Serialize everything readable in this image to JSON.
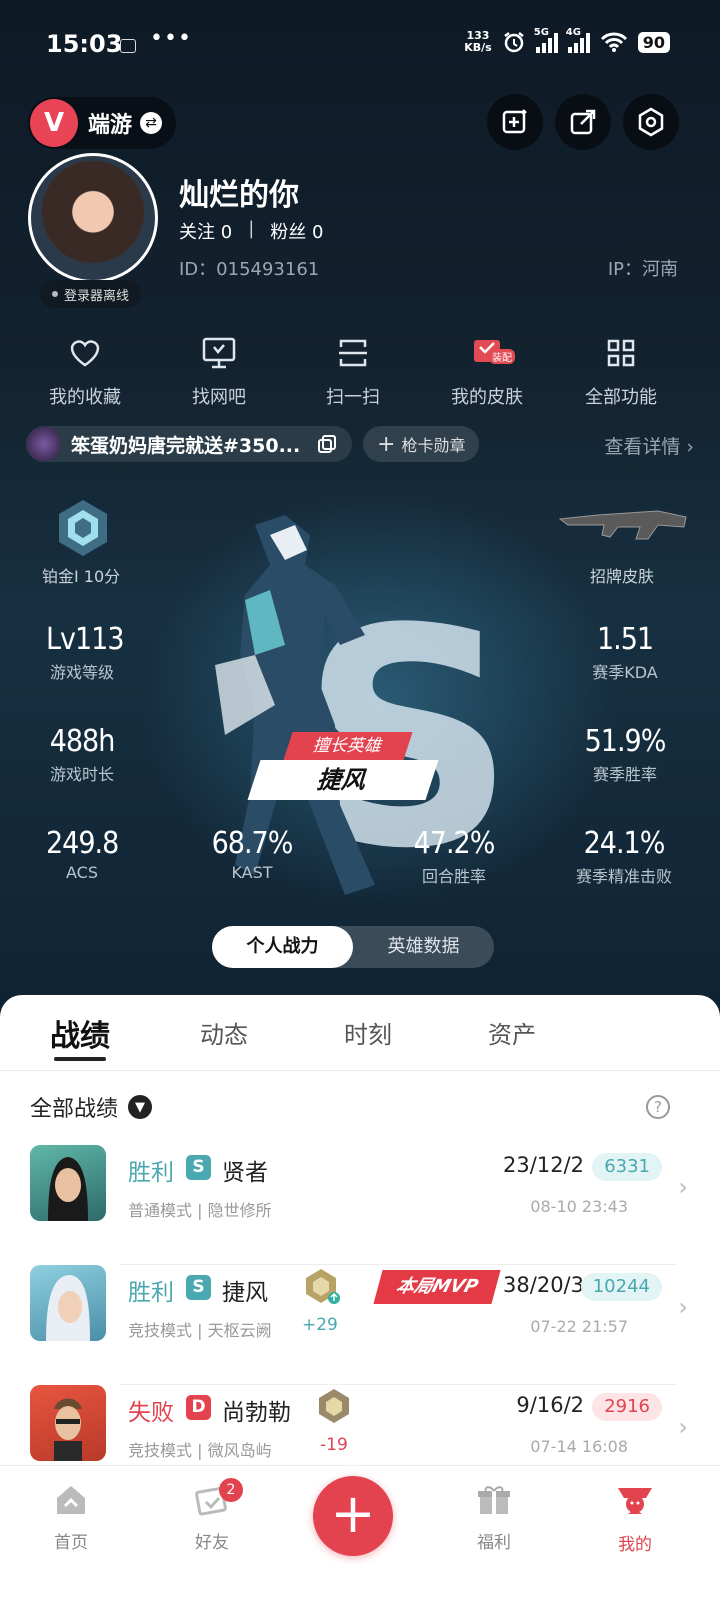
{
  "status_bar": {
    "time": "15:03",
    "misc": "图标",
    "dots": "•••",
    "net_speed_value": "133",
    "net_speed_unit": "KB/s",
    "sig1_label": "5G",
    "sig2_label": "4G",
    "battery": "90"
  },
  "header": {
    "game_name": "端游",
    "game_logo_glyph": "V"
  },
  "profile": {
    "nickname": "灿烂的你",
    "following_label": "关注",
    "following_count": "0",
    "separator": "|",
    "fans_label": "粉丝",
    "fans_count": "0",
    "id_text": "ID：015493161",
    "ip_text": "IP：河南",
    "login_status": "登录器离线"
  },
  "shortcuts": [
    {
      "label": "我的收藏",
      "icon": "heart-icon"
    },
    {
      "label": "找网吧",
      "icon": "monitor-icon"
    },
    {
      "label": "扫一扫",
      "icon": "scan-icon"
    },
    {
      "label": "我的皮肤",
      "icon": "skin-icon",
      "tag": "装配"
    },
    {
      "label": "全部功能",
      "icon": "grid-icon"
    }
  ],
  "title_bar": {
    "title": "笨蛋奶妈唐完就送#350...",
    "medal": "枪卡勋章",
    "detail": "查看详情"
  },
  "stats": {
    "rank": "铂金I 10分",
    "skin": "招牌皮肤",
    "level_value": "Lv113",
    "level_label": "游戏等级",
    "kda_value": "1.51",
    "kda_label": "赛季KDA",
    "hours_value": "488h",
    "hours_label": "游戏时长",
    "winrate_value": "51.9%",
    "winrate_label": "赛季胜率",
    "acs_value": "249.8",
    "acs_label": "ACS",
    "kast_value": "68.7%",
    "kast_label": "KAST",
    "round_value": "47.2%",
    "round_label": "回合胜率",
    "hs_value": "24.1%",
    "hs_label": "赛季精准击败",
    "hero_tag": "擅长英雄",
    "hero_name": "捷风",
    "hero_glyph": "S"
  },
  "toggle": {
    "on": "个人战力",
    "off": "英雄数据"
  },
  "tabs": [
    "战绩",
    "动态",
    "时刻",
    "资产"
  ],
  "filter": {
    "label": "全部战绩",
    "help": "?"
  },
  "matches": [
    {
      "result": "胜利",
      "grade": "S",
      "agent": "贤者",
      "mode": "普通模式 | 隐世修所",
      "kda": "23/12/2",
      "score": "6331",
      "date": "08-10 23:43",
      "win": true
    },
    {
      "result": "胜利",
      "grade": "S",
      "agent": "捷风",
      "mode": "竞技模式 | 天枢云阙",
      "kda": "38/20/3",
      "score": "10244",
      "date": "07-22 21:57",
      "rank_delta": "+29",
      "mvp": "本局MVP",
      "win": true
    },
    {
      "result": "失败",
      "grade": "D",
      "agent": "尚勃勒",
      "mode": "竞技模式 | 微风岛屿",
      "kda": "9/16/2",
      "score": "2916",
      "date": "07-14 16:08",
      "rank_delta": "-19",
      "win": false
    }
  ],
  "bottom_nav": {
    "home": "首页",
    "friends": "好友",
    "friends_badge": "2",
    "plus": "+",
    "welfare": "福利",
    "mine": "我的"
  },
  "colors": {
    "accent": "#e2434f",
    "win": "#4aa8b0",
    "loss": "#e2434f"
  }
}
